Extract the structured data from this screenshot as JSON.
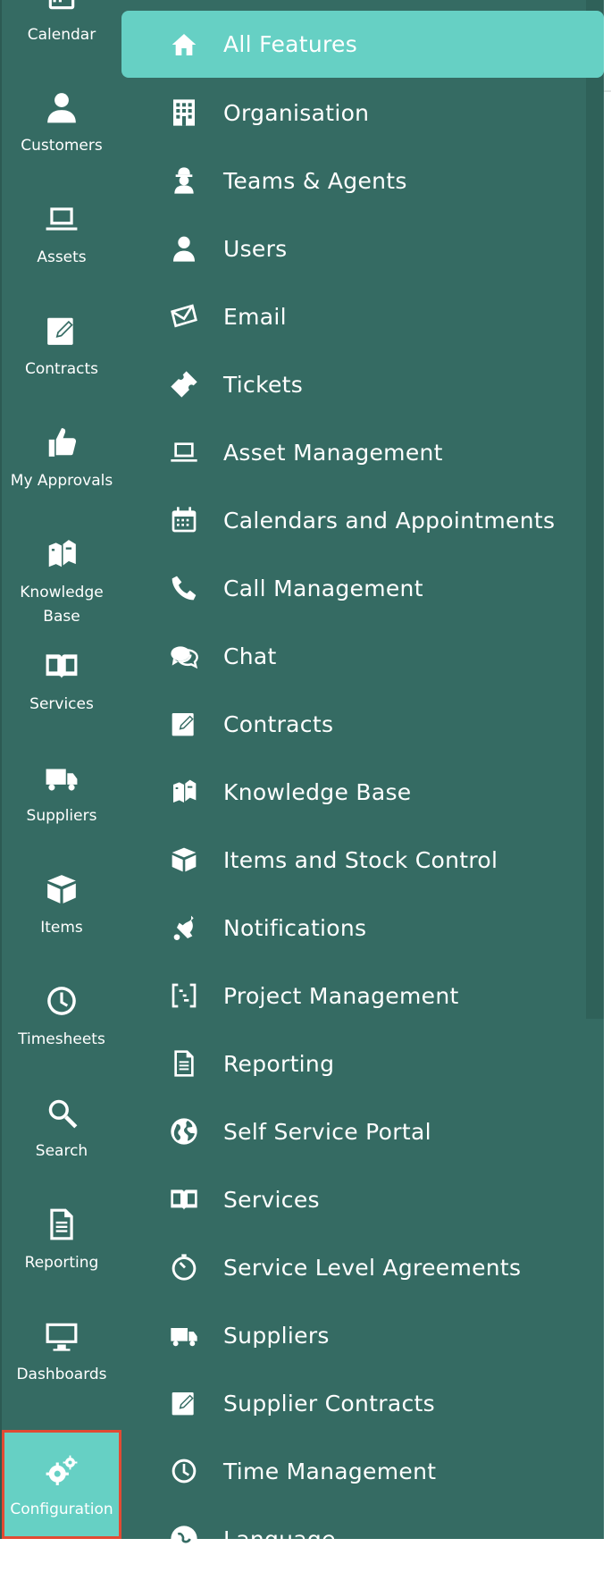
{
  "left_nav": {
    "items": [
      {
        "label": "Calendar",
        "icon": "calendar-icon"
      },
      {
        "label": "Customers",
        "icon": "user-icon"
      },
      {
        "label": "Assets",
        "icon": "laptop-icon"
      },
      {
        "label": "Contracts",
        "icon": "contract-edit-icon"
      },
      {
        "label": "My Approvals",
        "icon": "thumbs-up-icon"
      },
      {
        "label": "Knowledge Base",
        "icon": "books-icon"
      },
      {
        "label": "Services",
        "icon": "open-book-icon"
      },
      {
        "label": "Suppliers",
        "icon": "truck-icon"
      },
      {
        "label": "Items",
        "icon": "box-icon"
      },
      {
        "label": "Timesheets",
        "icon": "clock-icon"
      },
      {
        "label": "Search",
        "icon": "search-icon"
      },
      {
        "label": "Reporting",
        "icon": "document-icon"
      },
      {
        "label": "Dashboards",
        "icon": "monitor-icon"
      },
      {
        "label": "Configuration",
        "icon": "gears-icon",
        "active": true
      }
    ]
  },
  "flyout": {
    "items": [
      {
        "label": "All Features",
        "icon": "home-icon",
        "active": true
      },
      {
        "label": "Organisation",
        "icon": "building-icon"
      },
      {
        "label": "Teams & Agents",
        "icon": "agent-icon"
      },
      {
        "label": "Users",
        "icon": "user-icon"
      },
      {
        "label": "Email",
        "icon": "envelope-icon"
      },
      {
        "label": "Tickets",
        "icon": "ticket-icon"
      },
      {
        "label": "Asset Management",
        "icon": "laptop-icon"
      },
      {
        "label": "Calendars and Appointments",
        "icon": "calendar-icon"
      },
      {
        "label": "Call Management",
        "icon": "phone-icon"
      },
      {
        "label": "Chat",
        "icon": "chat-icon"
      },
      {
        "label": "Contracts",
        "icon": "contract-edit-icon"
      },
      {
        "label": "Knowledge Base",
        "icon": "books-icon"
      },
      {
        "label": "Items and Stock Control",
        "icon": "box-icon"
      },
      {
        "label": "Notifications",
        "icon": "bell-icon"
      },
      {
        "label": "Project Management",
        "icon": "project-icon"
      },
      {
        "label": "Reporting",
        "icon": "document-icon"
      },
      {
        "label": "Self Service Portal",
        "icon": "globe-icon"
      },
      {
        "label": "Services",
        "icon": "open-book-icon"
      },
      {
        "label": "Service Level Agreements",
        "icon": "stopwatch-icon"
      },
      {
        "label": "Suppliers",
        "icon": "truck-icon"
      },
      {
        "label": "Supplier Contracts",
        "icon": "contract-edit-icon"
      },
      {
        "label": "Time Management",
        "icon": "clock-icon"
      },
      {
        "label": "Language",
        "icon": "language-icon"
      }
    ]
  },
  "colors": {
    "sidebar": "#356b63",
    "active_bg": "#66d0c4",
    "highlight_border": "#e24a33",
    "text": "#ffffff"
  }
}
